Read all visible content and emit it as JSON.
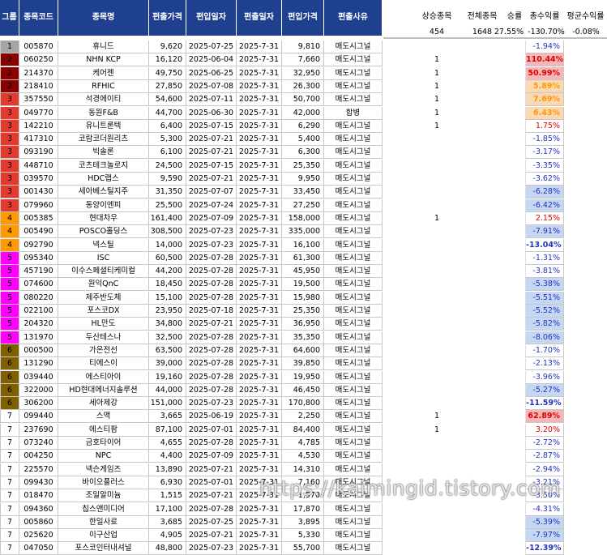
{
  "colors": {
    "header_bg": "#1f3f8f",
    "group_colors": {
      "1": "#a6a6a6",
      "2": "#8b0000",
      "3": "#e23b2e",
      "4": "#ff9900",
      "5": "#ff00ff",
      "6": "#806000",
      "7": "#ffffff"
    },
    "positive_strong_bg": "#f4b6b6",
    "positive_mid_bg": "#fbd8b4",
    "negative_bg": "#c5d7f2",
    "positive_text": "#e00000",
    "positive_mid_text": "#ff9900",
    "negative_text": "#2233bb"
  },
  "headers": {
    "group": "그룹",
    "code": "종목코드",
    "name": "종목명",
    "in_price": "편출가격",
    "in_date": "편입일자",
    "out_date": "편출일자",
    "out_price": "편입가격",
    "reason": "편출사유"
  },
  "summary": {
    "labels": [
      "상승종목",
      "전체종목",
      "승률",
      "총수익률",
      "평균수익률"
    ],
    "values": [
      "454",
      "1648",
      "27.55%",
      "-130.70%",
      "-0.08%"
    ]
  },
  "rows": [
    {
      "g": "1",
      "code": "005870",
      "name": "휴니드",
      "p1": "9,620",
      "d1": "2025-07-25",
      "d2": "2025-7-31",
      "p2": "9,810",
      "reason": "매도시그널",
      "up": "",
      "ret": "-1.94%",
      "hl": ""
    },
    {
      "g": "2",
      "code": "060250",
      "name": "NHN KCP",
      "p1": "16,120",
      "d1": "2025-06-04",
      "d2": "2025-7-31",
      "p2": "7,660",
      "reason": "매도시그널",
      "up": "1",
      "ret": "110.44%",
      "hl": "pos-strong"
    },
    {
      "g": "2",
      "code": "214370",
      "name": "케어젠",
      "p1": "49,750",
      "d1": "2025-06-25",
      "d2": "2025-7-31",
      "p2": "32,950",
      "reason": "매도시그널",
      "up": "1",
      "ret": "50.99%",
      "hl": "pos-strong"
    },
    {
      "g": "2",
      "code": "218410",
      "name": "RFHIC",
      "p1": "27,850",
      "d1": "2025-07-08",
      "d2": "2025-7-31",
      "p2": "26,300",
      "reason": "매도시그널",
      "up": "1",
      "ret": "5.89%",
      "hl": "pos-mid"
    },
    {
      "g": "3",
      "code": "357550",
      "name": "석경에이티",
      "p1": "54,600",
      "d1": "2025-07-11",
      "d2": "2025-7-31",
      "p2": "50,700",
      "reason": "매도시그널",
      "up": "1",
      "ret": "7.69%",
      "hl": "pos-mid"
    },
    {
      "g": "3",
      "code": "049770",
      "name": "동원F&B",
      "p1": "44,700",
      "d1": "2025-06-30",
      "d2": "2025-7-31",
      "p2": "42,000",
      "reason": "합병",
      "up": "1",
      "ret": "6.43%",
      "hl": "pos-mid"
    },
    {
      "g": "3",
      "code": "142210",
      "name": "유니트론텍",
      "p1": "6,400",
      "d1": "2025-07-15",
      "d2": "2025-7-31",
      "p2": "6,290",
      "reason": "매도시그널",
      "up": "1",
      "ret": "1.75%",
      "hl": "pos"
    },
    {
      "g": "3",
      "code": "417310",
      "name": "코람코더원리츠",
      "p1": "5,300",
      "d1": "2025-07-21",
      "d2": "2025-7-31",
      "p2": "5,400",
      "reason": "매도시그널",
      "up": "",
      "ret": "-1.85%",
      "hl": ""
    },
    {
      "g": "3",
      "code": "093190",
      "name": "빅솔론",
      "p1": "6,100",
      "d1": "2025-07-21",
      "d2": "2025-7-31",
      "p2": "6,300",
      "reason": "매도시그널",
      "up": "",
      "ret": "-3.17%",
      "hl": ""
    },
    {
      "g": "3",
      "code": "448710",
      "name": "코츠테크놀로지",
      "p1": "24,500",
      "d1": "2025-07-15",
      "d2": "2025-7-31",
      "p2": "25,350",
      "reason": "매도시그널",
      "up": "",
      "ret": "-3.35%",
      "hl": ""
    },
    {
      "g": "3",
      "code": "039570",
      "name": "HDC랩스",
      "p1": "9,590",
      "d1": "2025-07-21",
      "d2": "2025-7-31",
      "p2": "9,950",
      "reason": "매도시그널",
      "up": "",
      "ret": "-3.62%",
      "hl": ""
    },
    {
      "g": "3",
      "code": "001430",
      "name": "세아베스틸지주",
      "p1": "31,350",
      "d1": "2025-07-07",
      "d2": "2025-7-31",
      "p2": "33,450",
      "reason": "매도시그널",
      "up": "",
      "ret": "-6.28%",
      "hl": "neg"
    },
    {
      "g": "3",
      "code": "079960",
      "name": "동양이엔피",
      "p1": "25,500",
      "d1": "2025-07-24",
      "d2": "2025-7-31",
      "p2": "27,250",
      "reason": "매도시그널",
      "up": "",
      "ret": "-6.42%",
      "hl": "neg"
    },
    {
      "g": "4",
      "code": "005385",
      "name": "현대차우",
      "p1": "161,400",
      "d1": "2025-07-09",
      "d2": "2025-7-31",
      "p2": "158,000",
      "reason": "매도시그널",
      "up": "1",
      "ret": "2.15%",
      "hl": "pos"
    },
    {
      "g": "4",
      "code": "005490",
      "name": "POSCO홀딩스",
      "p1": "308,500",
      "d1": "2025-07-23",
      "d2": "2025-7-31",
      "p2": "335,000",
      "reason": "매도시그널",
      "up": "",
      "ret": "-7.91%",
      "hl": "neg"
    },
    {
      "g": "4",
      "code": "092790",
      "name": "넥스틸",
      "p1": "14,000",
      "d1": "2025-07-23",
      "d2": "2025-7-31",
      "p2": "16,100",
      "reason": "매도시그널",
      "up": "",
      "ret": "-13.04%",
      "hl": "neg-strong"
    },
    {
      "g": "5",
      "code": "095340",
      "name": "ISC",
      "p1": "60,500",
      "d1": "2025-07-28",
      "d2": "2025-7-31",
      "p2": "61,300",
      "reason": "매도시그널",
      "up": "",
      "ret": "-1.31%",
      "hl": ""
    },
    {
      "g": "5",
      "code": "457190",
      "name": "이수스페셜티케미컬",
      "p1": "44,200",
      "d1": "2025-07-28",
      "d2": "2025-7-31",
      "p2": "45,950",
      "reason": "매도시그널",
      "up": "",
      "ret": "-3.81%",
      "hl": ""
    },
    {
      "g": "5",
      "code": "074600",
      "name": "원익QnC",
      "p1": "18,450",
      "d1": "2025-07-28",
      "d2": "2025-7-31",
      "p2": "19,500",
      "reason": "매도시그널",
      "up": "",
      "ret": "-5.38%",
      "hl": "neg"
    },
    {
      "g": "5",
      "code": "080220",
      "name": "제주반도체",
      "p1": "15,100",
      "d1": "2025-07-28",
      "d2": "2025-7-31",
      "p2": "15,980",
      "reason": "매도시그널",
      "up": "",
      "ret": "-5.51%",
      "hl": "neg"
    },
    {
      "g": "5",
      "code": "022100",
      "name": "포스코DX",
      "p1": "23,950",
      "d1": "2025-07-18",
      "d2": "2025-7-31",
      "p2": "25,350",
      "reason": "매도시그널",
      "up": "",
      "ret": "-5.52%",
      "hl": "neg"
    },
    {
      "g": "5",
      "code": "204320",
      "name": "HL만도",
      "p1": "34,800",
      "d1": "2025-07-21",
      "d2": "2025-7-31",
      "p2": "36,950",
      "reason": "매도시그널",
      "up": "",
      "ret": "-5.82%",
      "hl": "neg"
    },
    {
      "g": "5",
      "code": "131970",
      "name": "두산테스나",
      "p1": "32,500",
      "d1": "2025-07-28",
      "d2": "2025-7-31",
      "p2": "35,350",
      "reason": "매도시그널",
      "up": "",
      "ret": "-8.06%",
      "hl": "neg"
    },
    {
      "g": "6",
      "code": "000500",
      "name": "가온전선",
      "p1": "63,500",
      "d1": "2025-07-28",
      "d2": "2025-7-31",
      "p2": "64,600",
      "reason": "매도시그널",
      "up": "",
      "ret": "-1.70%",
      "hl": ""
    },
    {
      "g": "6",
      "code": "131290",
      "name": "티에스이",
      "p1": "39,000",
      "d1": "2025-07-28",
      "d2": "2025-7-31",
      "p2": "39,850",
      "reason": "매도시그널",
      "up": "",
      "ret": "-2.13%",
      "hl": ""
    },
    {
      "g": "6",
      "code": "039440",
      "name": "에스티아이",
      "p1": "19,160",
      "d1": "2025-07-28",
      "d2": "2025-7-31",
      "p2": "19,950",
      "reason": "매도시그널",
      "up": "",
      "ret": "-3.96%",
      "hl": ""
    },
    {
      "g": "6",
      "code": "322000",
      "name": "HD현대에너지솔루션",
      "p1": "44,000",
      "d1": "2025-07-28",
      "d2": "2025-7-31",
      "p2": "46,450",
      "reason": "매도시그널",
      "up": "",
      "ret": "-5.27%",
      "hl": "neg"
    },
    {
      "g": "6",
      "code": "306200",
      "name": "세아제강",
      "p1": "151,000",
      "d1": "2025-07-23",
      "d2": "2025-7-31",
      "p2": "170,800",
      "reason": "매도시그널",
      "up": "",
      "ret": "-11.59%",
      "hl": "neg-strong"
    },
    {
      "g": "7",
      "code": "099440",
      "name": "스맥",
      "p1": "3,665",
      "d1": "2025-06-19",
      "d2": "2025-7-31",
      "p2": "2,250",
      "reason": "매도시그널",
      "up": "1",
      "ret": "62.89%",
      "hl": "pos-strong"
    },
    {
      "g": "7",
      "code": "237690",
      "name": "에스티팜",
      "p1": "87,100",
      "d1": "2025-07-01",
      "d2": "2025-7-31",
      "p2": "84,400",
      "reason": "매도시그널",
      "up": "1",
      "ret": "3.20%",
      "hl": "pos"
    },
    {
      "g": "7",
      "code": "073240",
      "name": "금호타이어",
      "p1": "4,655",
      "d1": "2025-07-28",
      "d2": "2025-7-31",
      "p2": "4,785",
      "reason": "매도시그널",
      "up": "",
      "ret": "-2.72%",
      "hl": ""
    },
    {
      "g": "7",
      "code": "004250",
      "name": "NPC",
      "p1": "4,400",
      "d1": "2025-07-09",
      "d2": "2025-7-31",
      "p2": "4,530",
      "reason": "매도시그널",
      "up": "",
      "ret": "-2.87%",
      "hl": ""
    },
    {
      "g": "7",
      "code": "225570",
      "name": "넥슨게임즈",
      "p1": "13,890",
      "d1": "2025-07-21",
      "d2": "2025-7-31",
      "p2": "14,310",
      "reason": "매도시그널",
      "up": "",
      "ret": "-2.94%",
      "hl": ""
    },
    {
      "g": "7",
      "code": "099430",
      "name": "바이오플러스",
      "p1": "6,930",
      "d1": "2025-07-01",
      "d2": "2025-7-31",
      "p2": "7,160",
      "reason": "매도시그널",
      "up": "",
      "ret": "-3.21%",
      "hl": ""
    },
    {
      "g": "7",
      "code": "018470",
      "name": "조일알미늄",
      "p1": "1,515",
      "d1": "2025-07-21",
      "d2": "2025-7-31",
      "p2": "1,570",
      "reason": "매도시그널",
      "up": "",
      "ret": "-3.50%",
      "hl": ""
    },
    {
      "g": "7",
      "code": "094360",
      "name": "칩스앤미디어",
      "p1": "17,100",
      "d1": "2025-07-28",
      "d2": "2025-7-31",
      "p2": "17,870",
      "reason": "매도시그널",
      "up": "",
      "ret": "-4.31%",
      "hl": ""
    },
    {
      "g": "7",
      "code": "005860",
      "name": "한일사료",
      "p1": "3,685",
      "d1": "2025-07-25",
      "d2": "2025-7-31",
      "p2": "3,895",
      "reason": "매도시그널",
      "up": "",
      "ret": "-5.39%",
      "hl": "neg"
    },
    {
      "g": "7",
      "code": "025620",
      "name": "이구산업",
      "p1": "4,905",
      "d1": "2025-07-21",
      "d2": "2025-7-31",
      "p2": "5,330",
      "reason": "매도시그널",
      "up": "",
      "ret": "-7.97%",
      "hl": "neg"
    },
    {
      "g": "7",
      "code": "047050",
      "name": "포스코인터내셔널",
      "p1": "48,800",
      "d1": "2025-07-23",
      "d2": "2025-7-31",
      "p2": "55,700",
      "reason": "매도시그널",
      "up": "",
      "ret": "-12.39%",
      "hl": "neg-strong"
    }
  ],
  "watermark": "https://kaimingid.tistory.com"
}
